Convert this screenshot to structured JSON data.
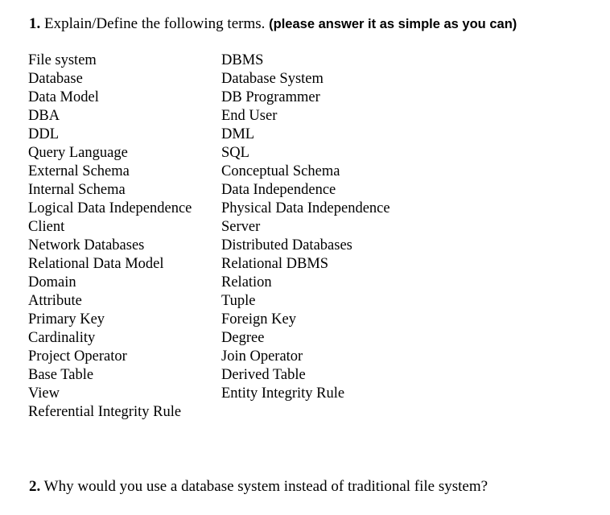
{
  "question1": {
    "number": "1.",
    "text": "Explain/Define the following terms.",
    "note": "(please answer it as simple as you can)"
  },
  "terms": {
    "left": [
      "File system",
      "Database",
      "Data Model",
      "DBA",
      "DDL",
      "Query Language",
      "External Schema",
      "Internal Schema",
      "Logical Data Independence",
      "Client",
      "Network Databases",
      "Relational Data Model",
      "Domain",
      "Attribute",
      "Primary Key",
      "Cardinality",
      "Project Operator",
      "Base Table",
      "View",
      "Referential Integrity Rule"
    ],
    "right": [
      "DBMS",
      "Database System",
      "DB Programmer",
      "End User",
      "DML",
      "SQL",
      "Conceptual Schema",
      "Data Independence",
      "Physical Data Independence",
      "Server",
      "Distributed Databases",
      "Relational DBMS",
      "Relation",
      "Tuple",
      "Foreign Key",
      "Degree",
      "Join Operator",
      "Derived Table",
      "Entity Integrity Rule",
      ""
    ]
  },
  "question2": {
    "number": "2.",
    "text": "Why would you use a database system instead of traditional file system?"
  }
}
